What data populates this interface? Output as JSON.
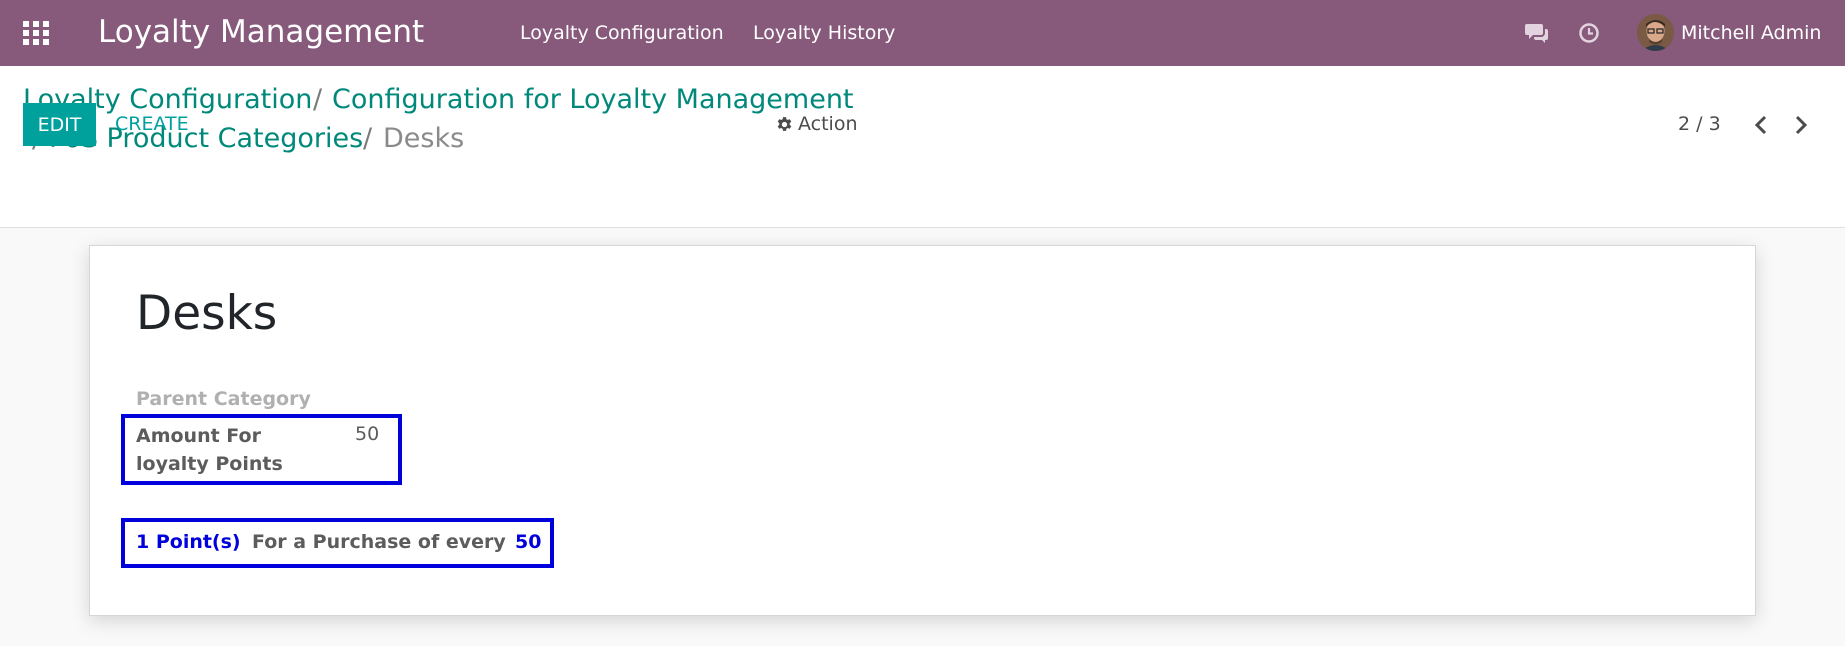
{
  "navbar": {
    "app_title": "Loyalty Management",
    "menu": [
      {
        "label": "Loyalty Configuration"
      },
      {
        "label": "Loyalty History"
      }
    ],
    "user_name": "Mitchell Admin",
    "icons": [
      "apps-grid-icon",
      "chat-icon",
      "clock-icon"
    ],
    "bg_color": "#875a7b"
  },
  "breadcrumb": {
    "items": [
      {
        "label": "Loyalty Configuration"
      },
      {
        "label": "Configuration for Loyalty Management"
      },
      {
        "label": "PoS Product Categories"
      }
    ],
    "current": "Desks",
    "separator": "/"
  },
  "toolbar": {
    "edit_label": "EDIT",
    "create_label": "CREATE",
    "action_label": "Action",
    "pager": "2 / 3",
    "accent_color": "#00a09d"
  },
  "record": {
    "title": "Desks",
    "parent_category_label": "Parent Category",
    "amount_label": "Amount For loyalty Points",
    "amount_value": "50",
    "rule": {
      "points": "1 Point(s)",
      "text": "For a Purchase of every",
      "amount": "50"
    },
    "highlight_color": "#0000dd"
  }
}
